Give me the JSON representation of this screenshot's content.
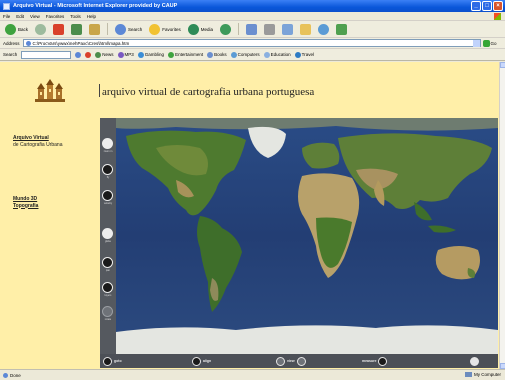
{
  "window": {
    "title": "Arquivo Virtual - Microsoft Internet Explorer provided by CAUP",
    "minimize": "_",
    "maximize": "□",
    "close": "×"
  },
  "menu": [
    "File",
    "Edit",
    "View",
    "Favorites",
    "Tools",
    "Help"
  ],
  "toolbar": {
    "back": "Back",
    "search": "Search",
    "favorites": "Favorites",
    "media": "Media"
  },
  "address": {
    "label": "Address",
    "value": "C:\\ProcVars\\ywwx\\nehPaxc\\Cres\\html\\mapa.htm",
    "go": "Go"
  },
  "links": {
    "label": "Search",
    "items": [
      "News",
      "MP3",
      "Gambling",
      "Entertainment",
      "Books",
      "Computers",
      "Education",
      "Travel"
    ]
  },
  "colors": {
    "page_bg": "#FFEFA8",
    "map_frame": "#5E636B",
    "ocean": "#263F75",
    "land_green": "#4E7A2F",
    "land_desert": "#B8A16A",
    "ice": "#E4E6E1"
  },
  "site": {
    "title": "arquivo virtual de cartografia urbana portuguesa",
    "nav": [
      {
        "bold": "Arquivo Virtual",
        "sub": "de Cartografia Urbana"
      },
      {
        "bold": "Mundo 3D",
        "sub": "Topografia"
      }
    ]
  },
  "viewer": {
    "left_tools": [
      {
        "icon": "zoom-in-icon",
        "label": "zoom in"
      },
      {
        "icon": "zoom-icon",
        "label": "fly"
      },
      {
        "icon": "rotate-icon",
        "label": "velocity"
      },
      {
        "icon": "globe-icon",
        "label": "globe"
      },
      {
        "icon": "pan-icon",
        "label": "pan"
      },
      {
        "icon": "layers-icon",
        "label": "layers"
      },
      {
        "icon": "reset-icon",
        "label": "rotate"
      }
    ],
    "bottom": {
      "goto": "goto",
      "align": "align",
      "view": "view",
      "measure": "measure"
    }
  },
  "status": {
    "left": "Done",
    "right": "My Computer"
  }
}
